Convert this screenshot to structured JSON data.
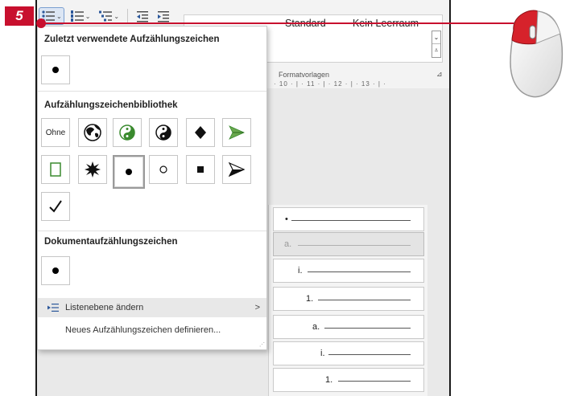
{
  "badge": {
    "label": "5"
  },
  "toolbar": {
    "buttons": [
      {
        "name": "bullets-button",
        "icon": "bullet-list-icon",
        "active": true
      },
      {
        "name": "numbering-button",
        "icon": "numbered-list-icon",
        "active": false
      },
      {
        "name": "multilevel-button",
        "icon": "multilevel-list-icon",
        "active": false
      },
      {
        "name": "decrease-indent-button",
        "icon": "decrease-indent-icon",
        "active": false
      },
      {
        "name": "increase-indent-button",
        "icon": "increase-indent-icon",
        "active": false
      }
    ]
  },
  "styles": {
    "items": [
      "Standard",
      "Kein Leerraum"
    ],
    "group_label": "Formatvorlagen",
    "more_icon": "chevron-down-icon"
  },
  "ruler": {
    "text": "· 10 · | · 11 · | · 12 · | · 13 · | ·"
  },
  "dropdown": {
    "recent_title": "Zuletzt verwendete Aufzählungszeichen",
    "library_title": "Aufzählungszeichenbibliothek",
    "document_title": "Dokumentaufzählungszeichen",
    "none_label": "Ohne",
    "library_items": [
      "none",
      "globe-icon",
      "yin-yang-green-icon",
      "yin-yang-icon",
      "diamond-icon",
      "arrow-green-icon",
      "square-outline-icon",
      "star-burst-icon",
      "filled-circle-icon",
      "hollow-circle-icon",
      "filled-square-icon",
      "arrowhead-icon",
      "checkmark-icon"
    ],
    "change_level_label": "Listenebene ändern",
    "define_new_label": "Neues Aufzählungszeichen definieren...",
    "submenu_arrow": ">"
  },
  "levels": {
    "markers": [
      "•",
      "a.",
      "i.",
      "1.",
      "a.",
      "i.",
      "1."
    ]
  },
  "colors": {
    "accent": "#c8102e",
    "active_button": "#dce6f4",
    "green_symbol": "#3a8a2e"
  }
}
